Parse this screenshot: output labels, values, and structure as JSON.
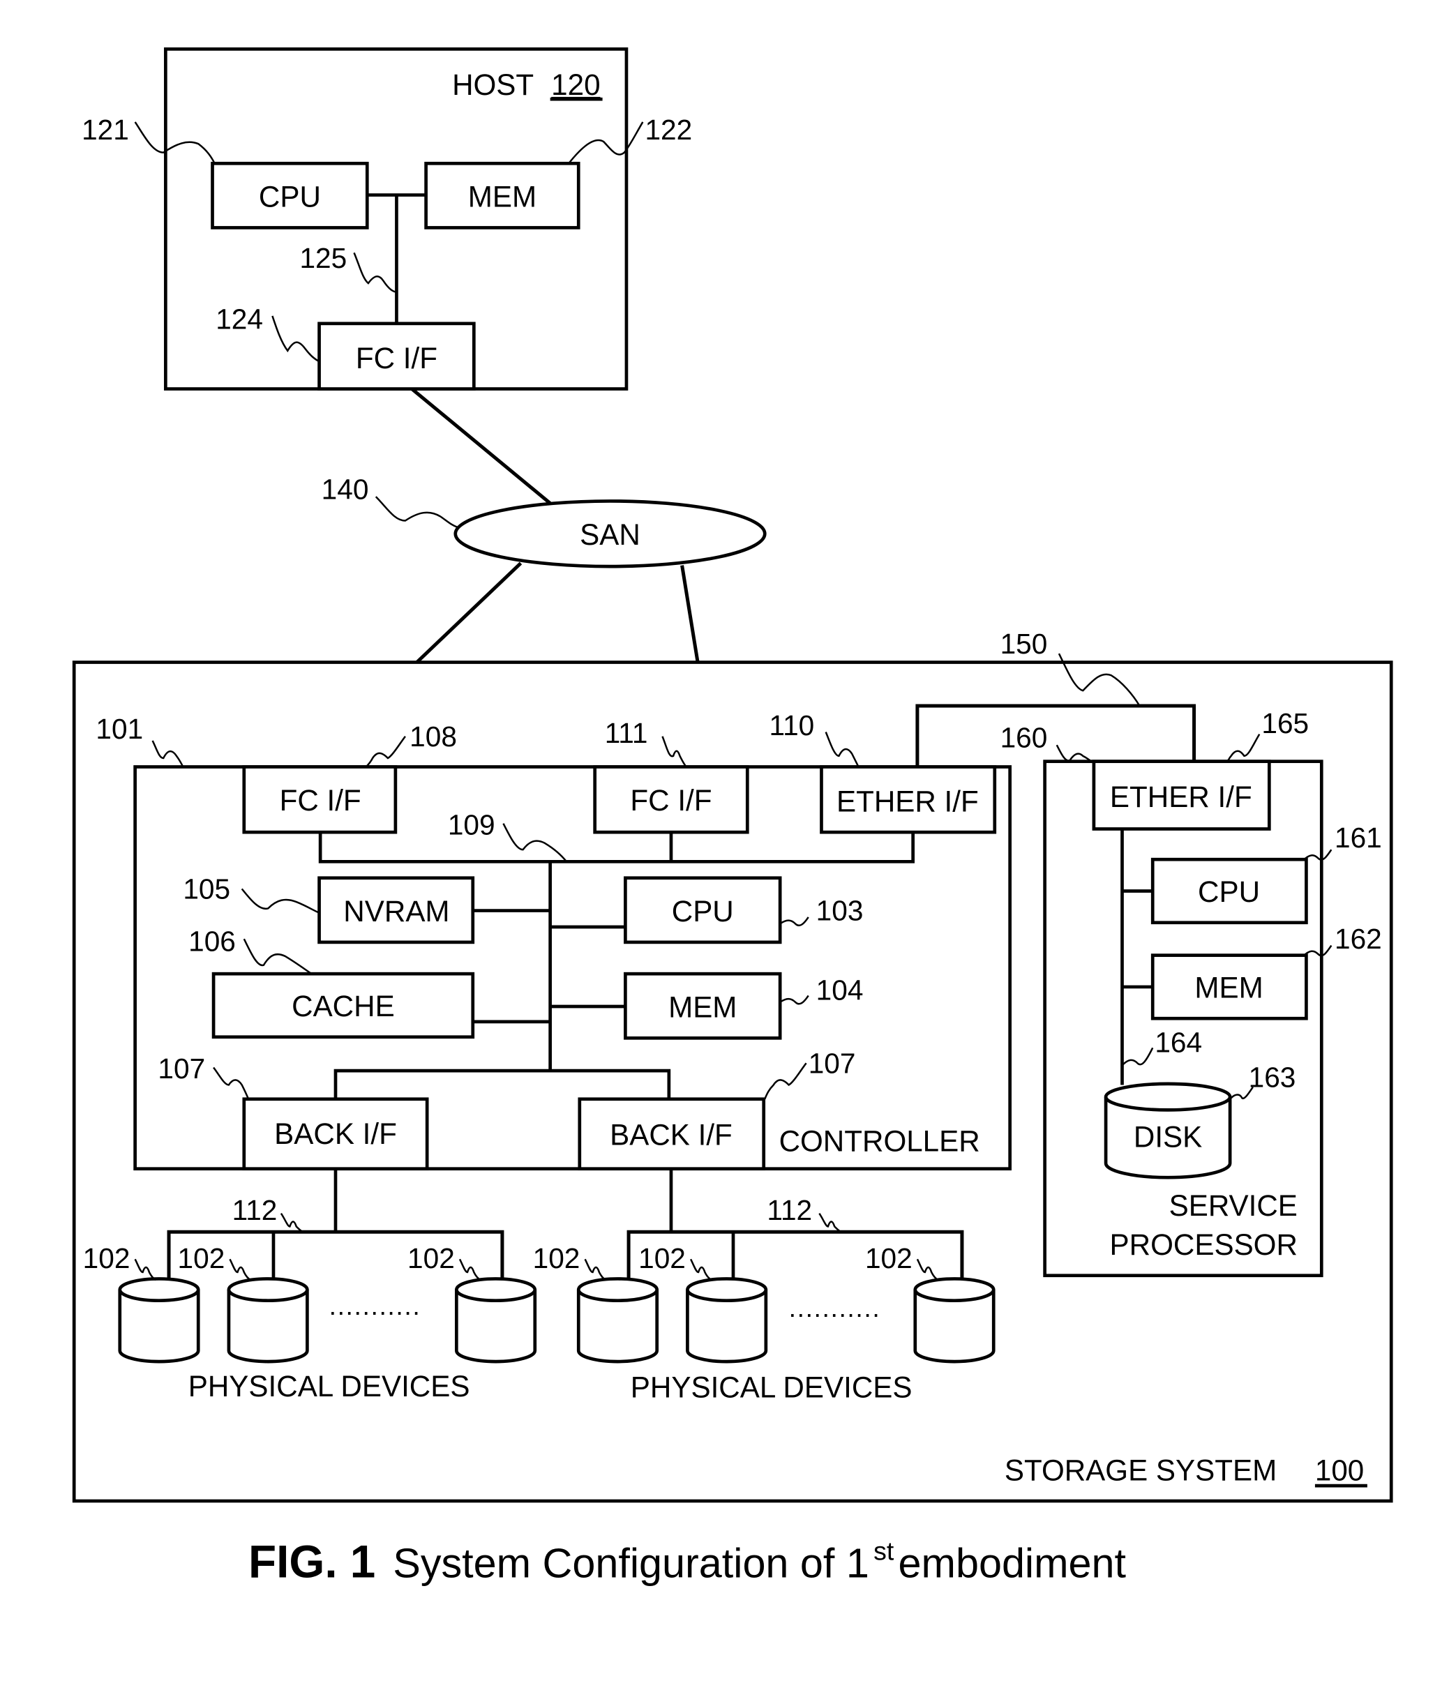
{
  "host": {
    "title": "HOST",
    "number": "120",
    "cpu": {
      "label": "CPU",
      "ref": "121"
    },
    "mem": {
      "label": "MEM",
      "ref": "122"
    },
    "bus_ref": "125",
    "fc_if": {
      "label": "FC I/F",
      "ref": "124"
    }
  },
  "san": {
    "label": "SAN",
    "ref": "140"
  },
  "network_ref": "150",
  "storage": {
    "title": "STORAGE SYSTEM",
    "number": "100",
    "controller": {
      "label": "CONTROLLER",
      "ref": "101",
      "fc_if_1": {
        "label": "FC I/F",
        "ref": "108"
      },
      "fc_if_2": {
        "label": "FC I/F",
        "ref": "111"
      },
      "ether_if": {
        "label": "ETHER I/F",
        "ref": "110"
      },
      "bus_ref": "109",
      "nvram": {
        "label": "NVRAM",
        "ref": "105"
      },
      "cache": {
        "label": "CACHE",
        "ref": "106"
      },
      "cpu": {
        "label": "CPU",
        "ref": "103"
      },
      "mem": {
        "label": "MEM",
        "ref": "104"
      },
      "back_if_1": {
        "label": "BACK I/F",
        "ref": "107"
      },
      "back_if_2": {
        "label": "BACK I/F",
        "ref": "107"
      }
    },
    "service_processor": {
      "label_line1": "SERVICE",
      "label_line2": "PROCESSOR",
      "ref": "160",
      "ether_if": {
        "label": "ETHER I/F",
        "ref": "165"
      },
      "cpu": {
        "label": "CPU",
        "ref": "161"
      },
      "mem": {
        "label": "MEM",
        "ref": "162"
      },
      "bus_ref": "164",
      "disk": {
        "label": "DISK",
        "ref": "163"
      }
    },
    "device_groups": [
      {
        "bus_ref": "112",
        "label": "PHYSICAL DEVICES",
        "device_refs": [
          "102",
          "102",
          "102"
        ],
        "ellipsis": "..........."
      },
      {
        "bus_ref": "112",
        "label": "PHYSICAL DEVICES",
        "device_refs": [
          "102",
          "102",
          "102"
        ],
        "ellipsis": "..........."
      }
    ]
  },
  "caption": {
    "fig": "FIG. 1",
    "text_before_sup": "System Configuration of 1",
    "sup": "st",
    "text_after_sup": " embodiment"
  }
}
